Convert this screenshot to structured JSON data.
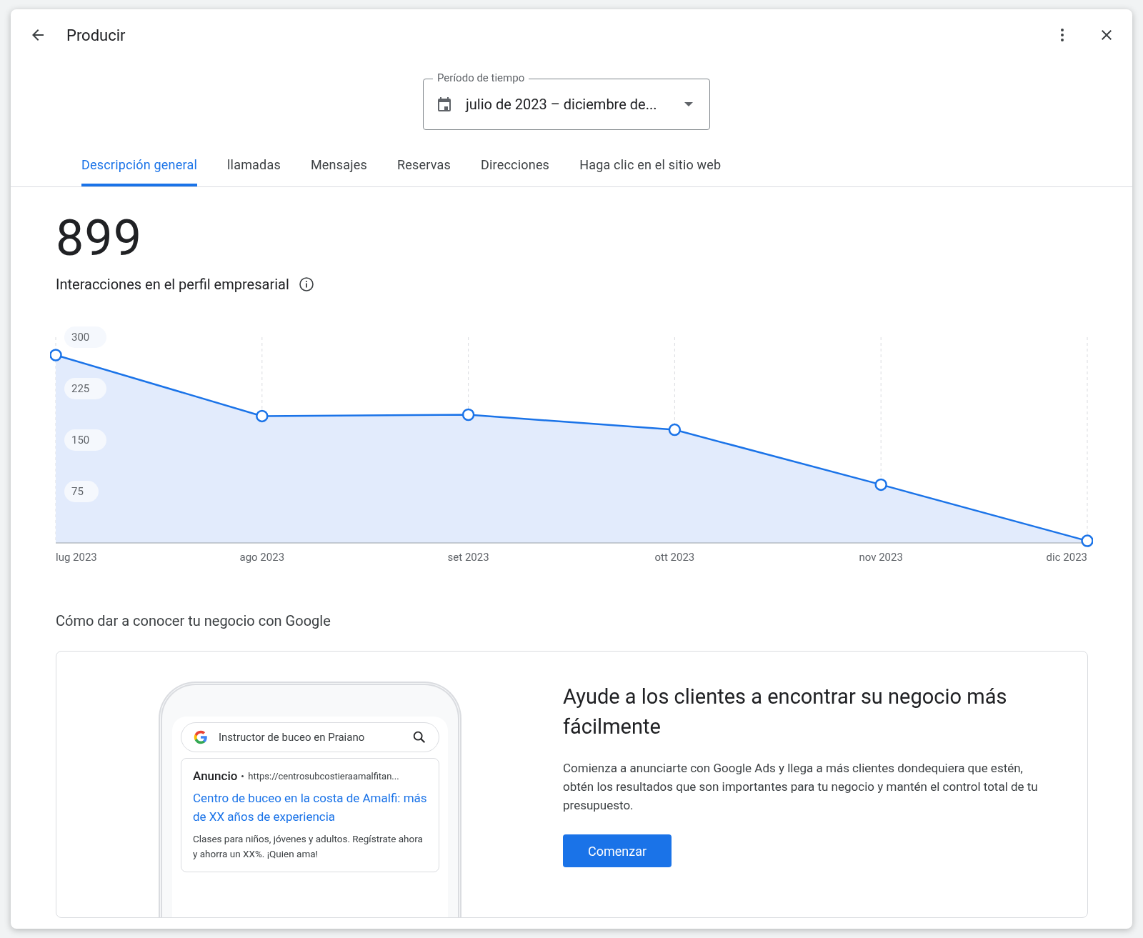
{
  "window": {
    "title": "Producir"
  },
  "period": {
    "label": "Período de tiempo",
    "value": "julio de 2023 – diciembre de..."
  },
  "tabs": [
    {
      "label": "Descripción general",
      "selected": true
    },
    {
      "label": "llamadas",
      "selected": false
    },
    {
      "label": "Mensajes",
      "selected": false
    },
    {
      "label": "Reservas",
      "selected": false
    },
    {
      "label": "Direcciones",
      "selected": false
    },
    {
      "label": "Haga clic en el sitio web",
      "selected": false
    }
  ],
  "summary": {
    "total": "899",
    "label": "Interacciones en el perfil empresarial"
  },
  "chart_data": {
    "type": "area",
    "categories": [
      "lug 2023",
      "ago 2023",
      "set 2023",
      "ott 2023",
      "nov 2023",
      "dic 2023"
    ],
    "series": [
      {
        "color": "#1a73e8",
        "values": [
          274,
          185,
          187,
          165,
          85,
          3
        ]
      }
    ],
    "grid": true,
    "ylim": [
      0,
      300
    ],
    "yticks": [
      75,
      150,
      225,
      300
    ]
  },
  "promo": {
    "heading": "Cómo dar a conocer tu negocio con Google",
    "search_query": "Instructor de buceo en Praiano",
    "ad_label": "Anuncio",
    "ad_url": "https://centrosubcostieraamalfitan...",
    "ad_title": "Centro de buceo en la costa de Amalfi: más de XX años de experiencia",
    "ad_text": "Clases para niños, jóvenes y adultos. Regístrate ahora y ahorra un XX%. ¡Quien ama!",
    "title": "Ayude a los clientes a encontrar su negocio más fácilmente",
    "text": "Comienza a anunciarte con Google Ads y llega a más clientes dondequiera que estén, obtén los resultados que son importantes para tu negocio y mantén el control total de tu presupuesto.",
    "button": "Comenzar"
  }
}
